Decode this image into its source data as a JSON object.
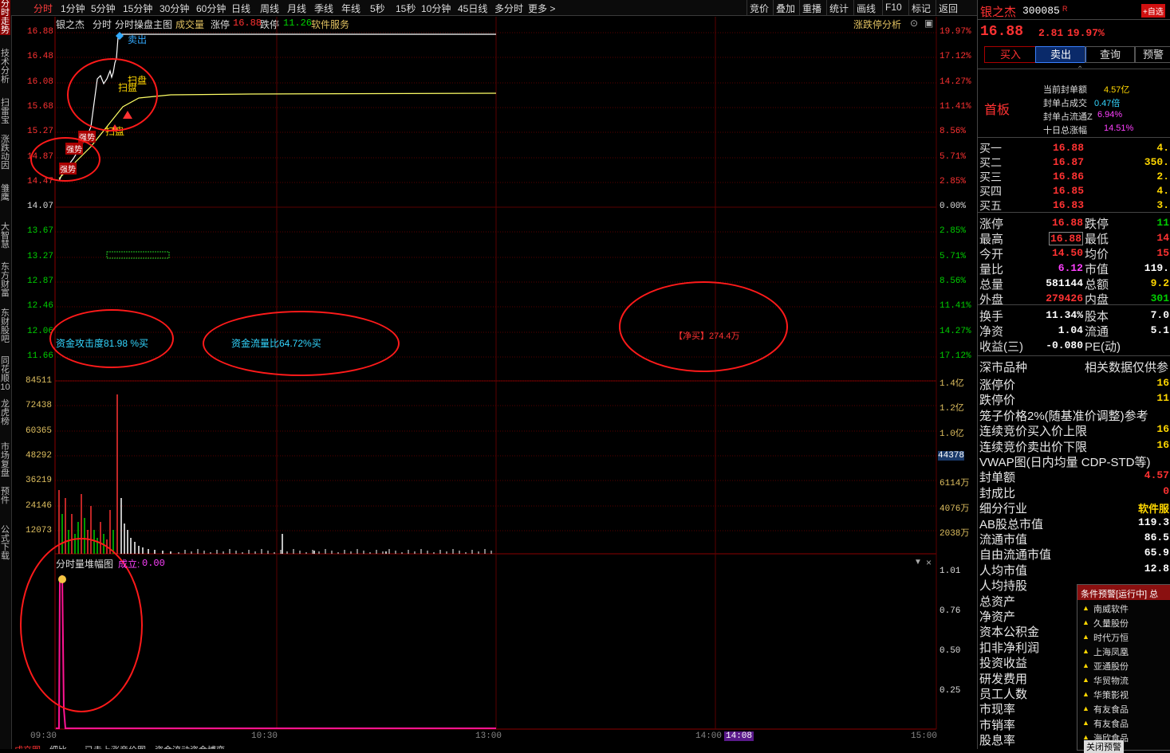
{
  "left_tabs": [
    "分时走势",
    "技术分析",
    "扫雷宝",
    "涨跌动因",
    "雏鹰",
    "大智慧",
    "东方财富",
    "东财股吧",
    "同花顺10",
    "龙虎榜",
    "市场复盘",
    "预件",
    "公式下载"
  ],
  "periods": [
    "分时",
    "1分钟",
    "5分钟",
    "15分钟",
    "30分钟",
    "60分钟",
    "日线",
    "周线",
    "月线",
    "季线",
    "年线",
    "5秒",
    "15秒",
    "10分钟",
    "45日线",
    "多分时",
    "更多 >"
  ],
  "tools": [
    "竞价",
    "叠加",
    "重播",
    "统计",
    "画线",
    "F10",
    "标记",
    "返回"
  ],
  "header": {
    "name": "银之杰",
    "mode": "分时",
    "title": "分时操盘主图",
    "vol": "成交量",
    "zt_label": "涨停",
    "zt_val": "16.88",
    "dt_label": "跌停",
    "dt_val": "11.26",
    "sector": "软件服务",
    "right": "涨跌停分析"
  },
  "y_left": [
    "16.88",
    "16.48",
    "16.08",
    "15.68",
    "15.27",
    "14.87",
    "14.47",
    "14.07",
    "13.67",
    "13.27",
    "12.87",
    "12.46",
    "12.06",
    "11.66"
  ],
  "y_right_pct": [
    "19.97%",
    "17.12%",
    "14.27%",
    "11.41%",
    "8.56%",
    "5.71%",
    "2.85%",
    "0.00%",
    "2.85%",
    "5.71%",
    "8.56%",
    "11.41%",
    "14.27%",
    "17.12%"
  ],
  "vol_left": [
    "84511",
    "72438",
    "60365",
    "48292",
    "36219",
    "24146",
    "12073"
  ],
  "vol_right": [
    "1.4亿",
    "1.2亿",
    "1.0亿",
    "44378",
    "6114万",
    "4076万",
    "2038万"
  ],
  "stack": {
    "title": "分时量堆幅图",
    "label": "成立:",
    "val": "0.00",
    "ticks": [
      "1.01",
      "0.76",
      "0.50",
      "0.25"
    ]
  },
  "time_axis": [
    "09:30",
    "10:30",
    "13:00",
    "14:00",
    "14:08",
    "15:00"
  ],
  "annotations": {
    "attack": "资金攻击度81.98 %买",
    "flow": "资金流量比64.72%买",
    "net_buy": "【净买】274.4万",
    "sell_tag": "卖出",
    "sweep1": "扫盘",
    "sweep2": "扫盘",
    "sweep3": "扫盘",
    "strong1": "强势",
    "strong2": "强势",
    "strong3": "强势"
  },
  "quote": {
    "name": "银之杰",
    "code": "300085",
    "tag": "R",
    "add": "+自选",
    "price": "16.88",
    "chg": "2.81",
    "pct": "19.97%",
    "buy_btn": "买入",
    "sell_btn": "卖出",
    "query_btn": "查询",
    "alert_btn": "预警",
    "board": "首板",
    "seal": [
      {
        "k": "当前封单额",
        "v": "4.57亿"
      },
      {
        "k": "封单占成交",
        "v": "0.47倍"
      },
      {
        "k": "封单占流通Z",
        "v": "6.94%"
      },
      {
        "k": "十日总涨幅",
        "v": "14.51%"
      }
    ],
    "bids": [
      {
        "k": "买一",
        "p": "16.88",
        "v": "4."
      },
      {
        "k": "买二",
        "p": "16.87",
        "v": "350."
      },
      {
        "k": "买三",
        "p": "16.86",
        "v": "2."
      },
      {
        "k": "买四",
        "p": "16.85",
        "v": "4."
      },
      {
        "k": "买五",
        "p": "16.83",
        "v": "3."
      }
    ],
    "stats": [
      {
        "k": "涨停",
        "v": "16.88",
        "k2": "跌停",
        "v2": "11"
      },
      {
        "k": "最高",
        "v": "16.88",
        "k2": "最低",
        "v2": "14"
      },
      {
        "k": "今开",
        "v": "14.50",
        "k2": "均价",
        "v2": "15"
      },
      {
        "k": "量比",
        "v": "6.12",
        "k2": "市值",
        "v2": "119."
      },
      {
        "k": "总量",
        "v": "581144",
        "k2": "总额",
        "v2": "9.2"
      },
      {
        "k": "外盘",
        "v": "279426",
        "k2": "内盘",
        "v2": "301"
      }
    ],
    "fin": [
      {
        "k": "换手",
        "v": "11.34%",
        "k2": "股本",
        "v2": "7.0"
      },
      {
        "k": "净资",
        "v": "1.04",
        "k2": "流通",
        "v2": "5.1"
      },
      {
        "k": "收益(三)",
        "v": "-0.080",
        "k2": "PE(动)",
        "v2": ""
      }
    ],
    "market": "深市品种",
    "market_note": "相关数据仅供参",
    "extra": [
      {
        "k": "涨停价",
        "v": "16"
      },
      {
        "k": "跌停价",
        "v": "11"
      },
      {
        "k": "笼子价格2%(随基准价调整)参考",
        "v": ""
      },
      {
        "k": "连续竞价买入价上限",
        "v": "16"
      },
      {
        "k": "连续竞价卖出价下限",
        "v": "16"
      },
      {
        "k": "VWAP图(日内均量 CDP-STD等)",
        "v": ""
      },
      {
        "k": "封单额",
        "v": "4.57"
      },
      {
        "k": "封成比",
        "v": "0"
      },
      {
        "k": "细分行业",
        "v": "软件服"
      },
      {
        "k": "AB股总市值",
        "v": "119.3"
      },
      {
        "k": "流通市值",
        "v": "86.5"
      },
      {
        "k": "自由流通市值",
        "v": "65.9"
      },
      {
        "k": "人均市值",
        "v": "12.8"
      },
      {
        "k": "人均持股",
        "v": ""
      },
      {
        "k": "总资产",
        "v": ""
      },
      {
        "k": "净资产",
        "v": ""
      },
      {
        "k": "资本公积金",
        "v": ""
      },
      {
        "k": "扣非净利润",
        "v": ""
      },
      {
        "k": "投资收益",
        "v": ""
      },
      {
        "k": "研发费用",
        "v": ""
      },
      {
        "k": "员工人数",
        "v": ""
      },
      {
        "k": "市现率",
        "v": ""
      },
      {
        "k": "市销率",
        "v": ""
      },
      {
        "k": "股息率",
        "v": ""
      }
    ]
  },
  "alert": {
    "title": "条件预警[运行中] 总",
    "close": "关闭预警",
    "items": [
      "南威软件",
      "久量股份",
      "时代万恒",
      "上海凤凰",
      "亚通股份",
      "华贸物流",
      "华策影视",
      "有友食品",
      "有友食品",
      "海欣食品"
    ]
  },
  "bottom_tabs": [
    "成交图",
    "细比",
    "已走上涨",
    "竞价图",
    "资金流动",
    "资金博弈"
  ],
  "colors": {
    "up": "#ff3232",
    "down": "#00d000",
    "price_line": "#ffffff",
    "avg_line": "#ffff66",
    "ellipse": "#ff1a1a",
    "stack_line": "#ff1493"
  }
}
